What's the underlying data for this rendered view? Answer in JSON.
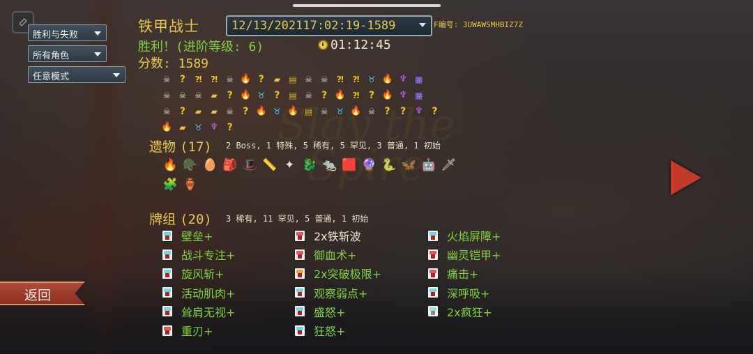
{
  "filters": [
    {
      "label": "胜利与失败"
    },
    {
      "label": "所有角色"
    },
    {
      "label": "任意模式"
    }
  ],
  "run": {
    "character": "铁甲战士",
    "selected_run": "12/13/202117:02:19-1589",
    "seed_label": "F编号: 3UWAWSMHBIZ7Z",
    "result": "胜利！(进阶等级: 6)",
    "time": "01:12:45",
    "score": "分数: 1589"
  },
  "path": [
    [
      "monster",
      "unknown",
      "unknown-monster",
      "unknown-monster",
      "monster",
      "rest",
      "unknown",
      "shop",
      "treasure",
      "monster",
      "monster",
      "unknown-monster",
      "unknown-monster",
      "elite",
      "rest",
      "boss",
      "chest"
    ],
    [
      "monster",
      "monster",
      "monster",
      "shop",
      "unknown",
      "rest",
      "elite",
      "unknown",
      "treasure",
      "monster",
      "unknown",
      "rest",
      "unknown-monster",
      "unknown",
      "rest",
      "boss",
      "chest"
    ],
    [
      "monster",
      "unknown",
      "shop",
      "shop",
      "monster",
      "unknown",
      "rest",
      "elite",
      "rest",
      "treasure",
      "monster",
      "elite",
      "rest",
      "monster",
      "unknown",
      "unknown",
      "boss",
      "unknown"
    ],
    [
      "rest",
      "shop",
      "elite",
      "boss",
      "unknown"
    ]
  ],
  "path_glyphs": {
    "monster": "☠",
    "unknown": "?",
    "unknown-monster": "⁈",
    "rest": "🔥",
    "shop": "▰",
    "treasure": "▤",
    "elite": "♉",
    "boss": "♆",
    "chest": "▦"
  },
  "relics_section": {
    "title": "遗物",
    "count": "(17)",
    "meta": "2 Boss, 1 特殊, 5 稀有, 5 罕见, 3 普通, 1 初始",
    "rows": [
      [
        "🔥",
        "🪖",
        "🥚",
        "🎒",
        "🎩",
        "📏",
        "✦",
        "🐉",
        "🐀",
        "🟥",
        "🔮",
        "🐍",
        "🦋",
        "🤖",
        "🗡"
      ],
      [
        "🧩",
        "🏺"
      ]
    ]
  },
  "deck_section": {
    "title": "牌组",
    "count": "(20)",
    "meta": "3 稀有, 11 罕见, 5 普通, 1 初始",
    "columns": [
      [
        {
          "label": "壁垒+",
          "type": "skill",
          "upgraded": true
        },
        {
          "label": "战斗专注+",
          "type": "skill",
          "upgraded": true
        },
        {
          "label": "旋风斩+",
          "type": "skill",
          "upgraded": true
        },
        {
          "label": "活动肌肉+",
          "type": "skill",
          "upgraded": true
        },
        {
          "label": "耸肩无视+",
          "type": "skill",
          "upgraded": true
        },
        {
          "label": "重刃+",
          "type": "attack",
          "upgraded": true
        }
      ],
      [
        {
          "label": "2x铁斩波",
          "type": "attack",
          "upgraded": false
        },
        {
          "label": "御血术+",
          "type": "attack",
          "upgraded": true
        },
        {
          "label": "2x突破极限+",
          "type": "power",
          "upgraded": true
        },
        {
          "label": "观察弱点+",
          "type": "skill",
          "upgraded": true
        },
        {
          "label": "盛怒+",
          "type": "skill",
          "upgraded": true
        },
        {
          "label": "狂怒+",
          "type": "skill",
          "upgraded": true
        }
      ],
      [
        {
          "label": "火焰屏障+",
          "type": "skill",
          "upgraded": true
        },
        {
          "label": "幽灵铠甲+",
          "type": "attack",
          "upgraded": true
        },
        {
          "label": "痛击+",
          "type": "attack",
          "upgraded": true
        },
        {
          "label": "深呼吸+",
          "type": "skill",
          "upgraded": true
        },
        {
          "label": "2x疯狂+",
          "type": "curse",
          "upgraded": true
        }
      ]
    ]
  },
  "watermark": "Slay the Spire",
  "back_button": {
    "label": "返回"
  },
  "icons": {
    "menu": "menu-icon",
    "clock": "clock-icon",
    "next": "next-arrow-icon"
  },
  "colors": {
    "gold": "#e9c84a",
    "green": "#7fd23c",
    "back_red": "#b04a3a"
  }
}
